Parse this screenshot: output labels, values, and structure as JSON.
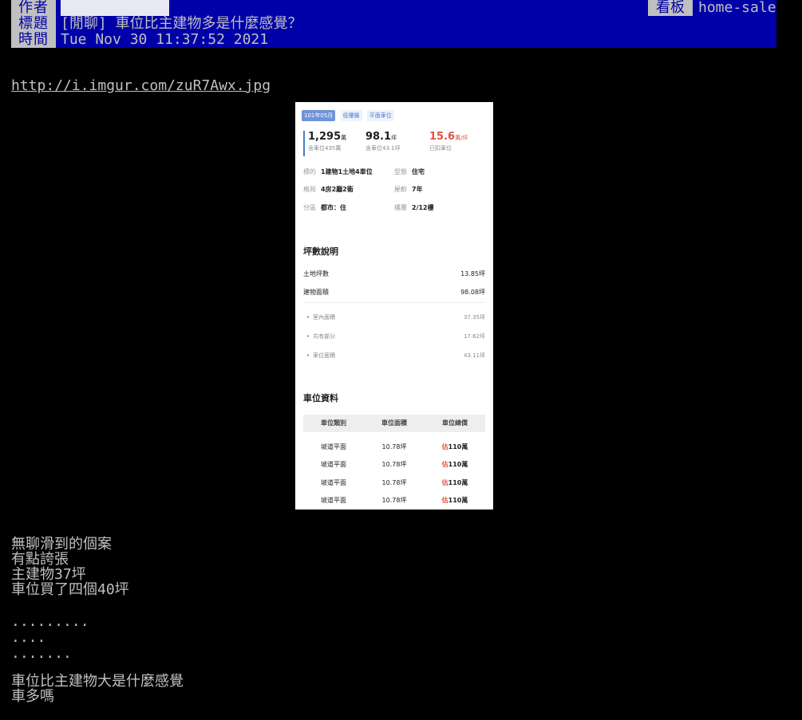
{
  "header": {
    "author_label": "作者",
    "title_label": "標題",
    "time_label": "時間",
    "board_label": "看板",
    "board_value": "home-sale",
    "title": "[閒聊] 車位比主建物多是什麼感覺？",
    "time": "Tue Nov 30 11:37:52 2021"
  },
  "link": "http://i.imgur.com/zuR7Awx.jpg",
  "screenshot": {
    "tags": [
      "101年05月",
      "低樓層",
      "平面車位"
    ],
    "stats": [
      {
        "value": "1,295",
        "unit": "萬",
        "sub": "含車位435萬"
      },
      {
        "value": "98.1",
        "unit": "坪",
        "sub": "含車位43.1坪"
      },
      {
        "value": "15.6",
        "unit": "萬/坪",
        "sub": "已扣車位"
      }
    ],
    "info": [
      {
        "k": "標的",
        "v": "1建物1土地4車位"
      },
      {
        "k": "型態",
        "v": "住宅"
      },
      {
        "k": "格局",
        "v": "4房2廳2衛"
      },
      {
        "k": "屋齡",
        "v": "7年"
      },
      {
        "k": "分區",
        "v": "都市：住"
      },
      {
        "k": "樓層",
        "v": "2/12樓"
      }
    ],
    "area_title": "坪數說明",
    "area_rows": [
      {
        "label": "土地坪數",
        "value": "13.85坪"
      },
      {
        "label": "建物面積",
        "value": "98.08坪"
      }
    ],
    "area_sub_rows": [
      {
        "label": "室內面積",
        "value": "37.35坪"
      },
      {
        "label": "共有部分",
        "value": "17.62坪"
      },
      {
        "label": "車位面積",
        "value": "43.11坪"
      }
    ],
    "parking_title": "車位資料",
    "parking_headers": [
      "車位類別",
      "車位面積",
      "車位總價"
    ],
    "parking_rows": [
      {
        "type": "坡道平面",
        "area": "10.78坪",
        "mark": "估",
        "price": "110萬"
      },
      {
        "type": "坡道平面",
        "area": "10.78坪",
        "mark": "估",
        "price": "110萬"
      },
      {
        "type": "坡道平面",
        "area": "10.78坪",
        "mark": "估",
        "price": "110萬"
      },
      {
        "type": "坡道平面",
        "area": "10.78坪",
        "mark": "估",
        "price": "110萬"
      }
    ]
  },
  "body": {
    "lines1": [
      "無聊滑到的個案",
      "有點誇張",
      "主建物37坪",
      "車位買了四個40坪"
    ],
    "dots": [
      ".........",
      "....",
      "......."
    ],
    "lines2": [
      "車位比主建物大是什麼感覺",
      "車多嗎"
    ]
  }
}
